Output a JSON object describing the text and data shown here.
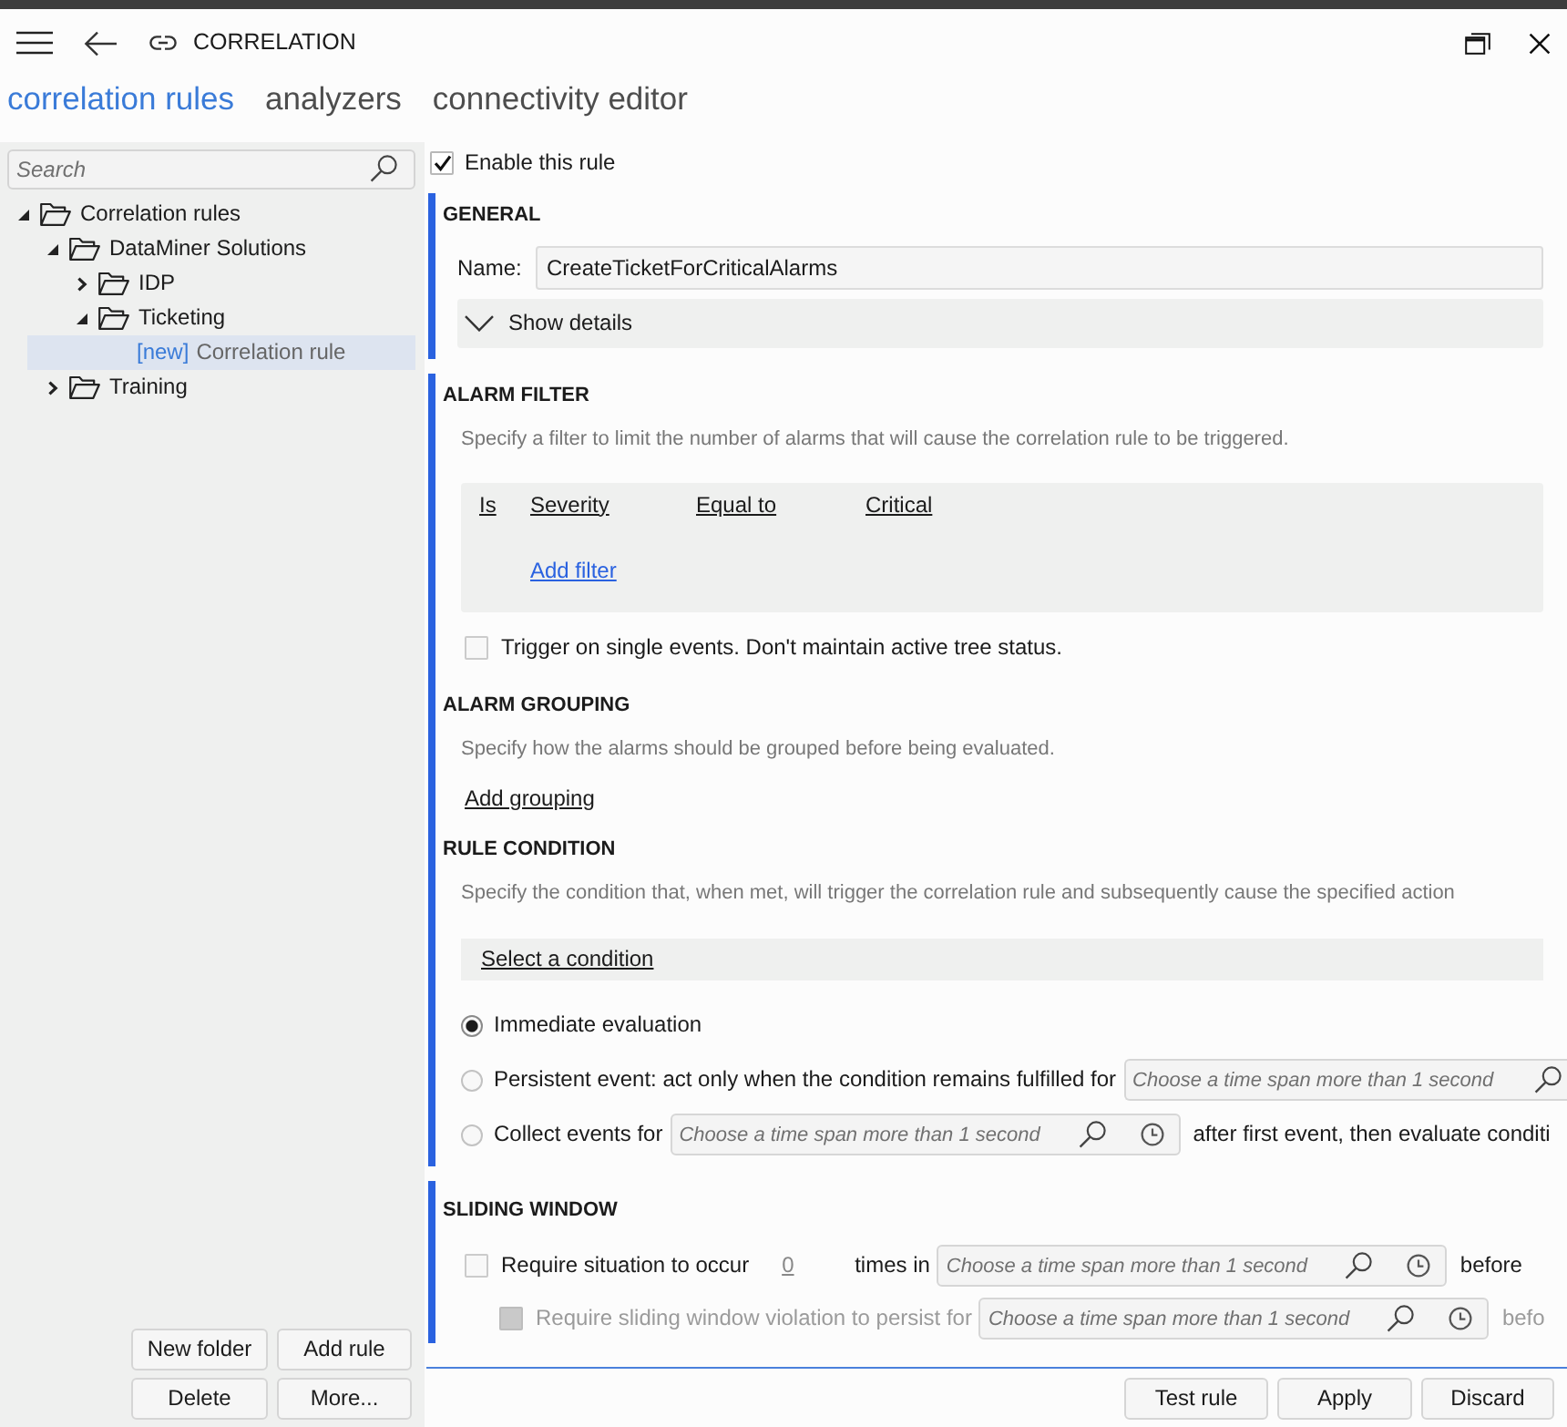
{
  "window": {
    "title": "CORRELATION"
  },
  "tabs": [
    {
      "label": "correlation rules",
      "selected": true
    },
    {
      "label": "analyzers",
      "selected": false
    },
    {
      "label": "connectivity editor",
      "selected": false
    }
  ],
  "sidebar": {
    "search": {
      "placeholder": "Search"
    },
    "tree": [
      {
        "kind": "folder",
        "label": "Correlation rules",
        "expanded": true,
        "selected": false,
        "children": [
          {
            "kind": "folder",
            "label": "DataMiner Solutions",
            "expanded": true,
            "selected": false,
            "children": [
              {
                "kind": "folder",
                "label": "IDP",
                "expanded": false,
                "selected": false
              },
              {
                "kind": "folder",
                "label": "Ticketing",
                "expanded": true,
                "selected": false,
                "children": [
                  {
                    "kind": "rule",
                    "tag": "[new]",
                    "label": "Correlation rule",
                    "selected": true
                  }
                ]
              }
            ]
          },
          {
            "kind": "folder",
            "label": "Training",
            "expanded": false,
            "selected": false
          }
        ]
      }
    ],
    "buttons": [
      "New folder",
      "Add rule",
      "Delete",
      "More..."
    ]
  },
  "enable_rule": {
    "label": "Enable this rule",
    "checked": true
  },
  "groups": [
    {
      "sections": [
        {
          "title": "GENERAL",
          "items": [
            {
              "kind": "text_field",
              "label": "Name:",
              "value": "CreateTicketForCriticalAlarms"
            },
            {
              "kind": "expander",
              "label": "Show details",
              "expanded": false
            }
          ]
        }
      ]
    },
    {
      "sections": [
        {
          "title": "ALARM FILTER",
          "items": [
            {
              "kind": "description",
              "text": "Specify a filter to limit the number of alarms that will cause the correlation rule to be triggered."
            },
            {
              "kind": "filter_box",
              "filters": [
                {
                  "negation": "Is",
                  "field": "Severity",
                  "operator": "Equal to",
                  "value": "Critical"
                }
              ],
              "add_label": "Add filter"
            },
            {
              "kind": "checkbox",
              "checked": false,
              "disabled": false,
              "parts": [
                {
                  "kind": "text",
                  "text": "Trigger on single events. Don't maintain active tree status."
                }
              ]
            }
          ]
        },
        {
          "title": "ALARM GROUPING",
          "items": [
            {
              "kind": "description",
              "text": "Specify how the alarms should be grouped before being evaluated."
            },
            {
              "kind": "link",
              "label": "Add grouping"
            }
          ]
        },
        {
          "title": "RULE CONDITION",
          "items": [
            {
              "kind": "description",
              "text": "Specify the condition that, when met, will trigger the correlation rule and subsequently cause the specified action"
            },
            {
              "kind": "select_bar",
              "label": "Select a condition"
            },
            {
              "kind": "radio",
              "selected": true,
              "parts": [
                {
                  "kind": "text",
                  "text": "Immediate evaluation"
                }
              ]
            },
            {
              "kind": "radio",
              "selected": false,
              "parts": [
                {
                  "kind": "text",
                  "text": "Persistent event: act only when the condition remains fulfilled for"
                },
                {
                  "kind": "time_field",
                  "placeholder": "Choose a time span more than 1 second",
                  "clipped": true
                }
              ]
            },
            {
              "kind": "radio",
              "selected": false,
              "parts": [
                {
                  "kind": "text",
                  "text": "Collect events for"
                },
                {
                  "kind": "time_field",
                  "placeholder": "Choose a time span more than 1 second",
                  "clipped": false
                },
                {
                  "kind": "text",
                  "text": "after first event, then evaluate conditi"
                }
              ]
            }
          ]
        }
      ]
    },
    {
      "sections": [
        {
          "title": "SLIDING WINDOW",
          "items": [
            {
              "kind": "checkbox",
              "checked": false,
              "disabled": false,
              "parts": [
                {
                  "kind": "text",
                  "text": "Require situation to occur"
                },
                {
                  "kind": "number",
                  "text": "0"
                },
                {
                  "kind": "text",
                  "text": "times in"
                },
                {
                  "kind": "time_field",
                  "placeholder": "Choose a time span more than 1 second",
                  "clipped": false
                },
                {
                  "kind": "text",
                  "text": "before"
                }
              ],
              "children": [
                {
                  "kind": "checkbox",
                  "checked": false,
                  "disabled": true,
                  "parts": [
                    {
                      "kind": "text",
                      "text": "Require sliding window violation to persist for"
                    },
                    {
                      "kind": "time_field",
                      "placeholder": "Choose a time span more than 1 second",
                      "clipped": false
                    },
                    {
                      "kind": "text",
                      "text": "befo"
                    }
                  ]
                }
              ]
            }
          ]
        }
      ]
    }
  ],
  "footer": {
    "buttons": [
      "Test rule",
      "Apply",
      "Discard"
    ]
  }
}
